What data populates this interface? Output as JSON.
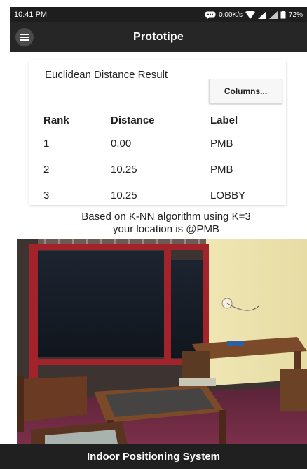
{
  "status_bar": {
    "time": "10:41 PM",
    "network_speed": "0.00K/s",
    "battery": "72%",
    "icons": [
      "chat-icon",
      "wifi-icon",
      "signal-icon",
      "signal-icon",
      "battery-icon"
    ]
  },
  "app_bar": {
    "title": "Prototipe",
    "menu_icon": "hamburger-menu-icon"
  },
  "result": {
    "title": "Euclidean Distance Result",
    "columns_button": "Columns...",
    "headers": [
      "Rank",
      "Distance",
      "Label"
    ],
    "rows": [
      [
        "1",
        "0.00",
        "PMB"
      ],
      [
        "2",
        "10.25",
        "PMB"
      ],
      [
        "3",
        "10.25",
        "LOBBY"
      ]
    ]
  },
  "knn": {
    "line1": "Based on K-NN algorithm using K=3",
    "line2": "your location is @PMB"
  },
  "footer": {
    "title": "Indoor Positioning System"
  },
  "colors": {
    "appbar": "#262626",
    "statusbar": "#1e1e1e",
    "footer": "#202020",
    "window_frame": "#a3232b"
  }
}
